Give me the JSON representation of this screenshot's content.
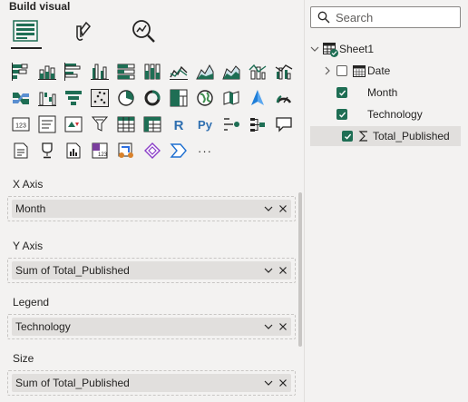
{
  "panel": {
    "title": "Build visual"
  },
  "tabs": [
    {
      "name": "build-visual",
      "icon": "visual-grid-icon",
      "active": true
    },
    {
      "name": "format-visual",
      "icon": "paintbrush-icon",
      "active": false
    },
    {
      "name": "analytics",
      "icon": "magnifier-chart-icon",
      "active": false
    }
  ],
  "visual_gallery": [
    [
      "stacked-bar-chart-icon",
      "stacked-column-chart-icon",
      "clustered-bar-chart-icon",
      "clustered-column-chart-icon",
      "100-percent-bar-chart-icon",
      "100-percent-column-chart-icon",
      "line-chart-icon",
      "area-chart-icon",
      "stacked-area-chart-icon",
      "line-column-chart-icon",
      "line-clustered-column-chart-icon"
    ],
    [
      "ribbon-chart-icon",
      "waterfall-chart-icon",
      "funnel-chart-icon",
      "scatter-chart-icon",
      "pie-chart-icon",
      "donut-chart-icon",
      "treemap-icon",
      "map-icon",
      "filled-map-icon",
      "azure-map-icon",
      "gauge-icon"
    ],
    [
      "card-icon",
      "multi-row-card-icon",
      "kpi-icon",
      "slicer-icon",
      "table-icon",
      "matrix-icon",
      "r-visual-icon",
      "python-visual-icon",
      "key-influencers-icon",
      "decomposition-tree-icon",
      "qa-icon"
    ],
    [
      "smart-narrative-icon",
      "metrics-icon",
      "paginated-report-icon",
      "power-apps-icon",
      "power-automate-icon",
      "shape-icon",
      "chevron-icon",
      "more-visuals-icon"
    ]
  ],
  "more_label": "···",
  "wells": [
    {
      "label": "X Axis",
      "value": "Month"
    },
    {
      "label": "Y Axis",
      "value": "Sum of Total_Published"
    },
    {
      "label": "Legend",
      "value": "Technology"
    },
    {
      "label": "Size",
      "value": "Sum of Total_Published"
    }
  ],
  "fields": {
    "search": {
      "placeholder": "Search"
    },
    "table": {
      "name": "Sheet1",
      "icon": "table-icon",
      "expanded": true
    },
    "items": [
      {
        "name": "Date",
        "checked": false,
        "icon": "calendar-icon",
        "expandable": true,
        "selected": false
      },
      {
        "name": "Month",
        "checked": true,
        "icon": "",
        "expandable": false,
        "selected": false
      },
      {
        "name": "Technology",
        "checked": true,
        "icon": "",
        "expandable": false,
        "selected": false
      },
      {
        "name": "Total_Published",
        "checked": true,
        "icon": "sigma-icon",
        "expandable": false,
        "selected": true
      }
    ]
  },
  "colors": {
    "accent": "#1e6e54",
    "selected_row": "#e1dfdd",
    "panel_bg": "#f3f2f1"
  }
}
